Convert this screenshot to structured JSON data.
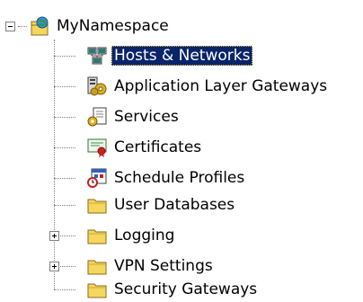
{
  "tree": {
    "root": {
      "label": "MyNamespace",
      "expanded": true,
      "icon": "namespace-icon"
    },
    "children": [
      {
        "label": "Hosts & Networks",
        "icon": "network-hosts-icon",
        "selected": true
      },
      {
        "label": "Application Layer Gateways",
        "icon": "gateway-gears-icon"
      },
      {
        "label": "Services",
        "icon": "services-icon"
      },
      {
        "label": "Certificates",
        "icon": "certificate-icon"
      },
      {
        "label": "Schedule Profiles",
        "icon": "calendar-clock-icon"
      },
      {
        "label": "User Databases",
        "icon": "folder-icon"
      },
      {
        "label": "Logging",
        "icon": "folder-icon",
        "expandable": true
      },
      {
        "label": "VPN Settings",
        "icon": "folder-icon",
        "expandable": true
      },
      {
        "label": "Security Gateways",
        "icon": "folder-icon"
      }
    ]
  },
  "colors": {
    "selection": "#0a246a",
    "folder": "#f4d75c",
    "tree_lines": "#808080"
  }
}
